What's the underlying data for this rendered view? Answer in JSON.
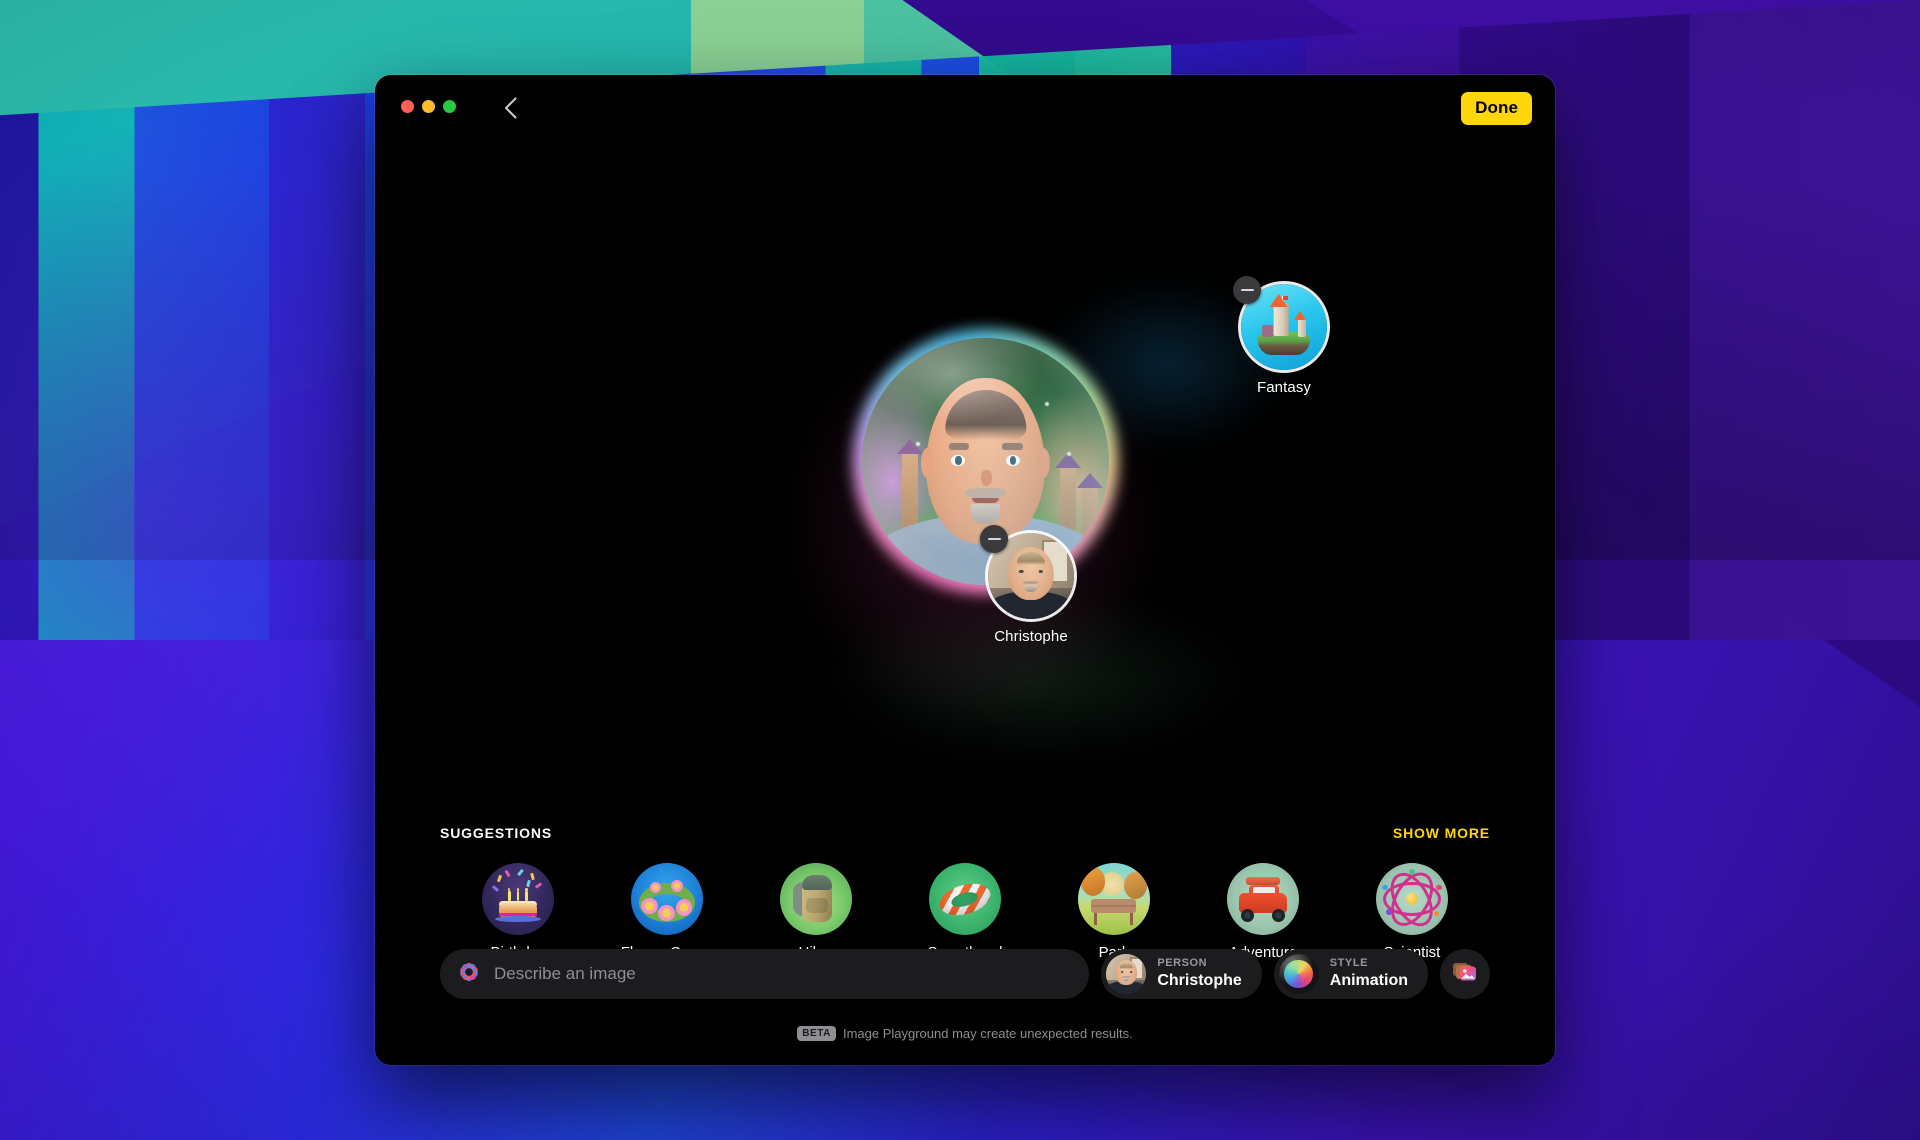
{
  "window": {
    "traffic_lights": {
      "close_label": "close-window",
      "minimize_label": "minimize-window",
      "zoom_label": "zoom-window",
      "close_color": "#ff5f57",
      "minimize_color": "#febc2e",
      "zoom_color": "#28c840"
    },
    "back_label": "Back",
    "done_label": "Done",
    "done_color": "#ffd60a",
    "background_color": "#000000"
  },
  "canvas": {
    "main_image": {
      "name": "generated-image",
      "alt": "Animated-style portrait of Christophe in a fantasy forest village"
    },
    "concepts": [
      {
        "id": "fantasy",
        "label": "Fantasy",
        "remove_label": "Remove Fantasy",
        "art": "castle-island-thumbnail"
      },
      {
        "id": "christophe",
        "label": "Christophe",
        "remove_label": "Remove Christophe",
        "art": "person-photo-thumbnail"
      }
    ]
  },
  "suggestions": {
    "title": "SUGGESTIONS",
    "show_more_label": "SHOW MORE",
    "show_more_color": "#ffd60a",
    "items": [
      {
        "id": "birthday",
        "label": "Birthday",
        "art": "birthday-cake-icon"
      },
      {
        "id": "flower-crown",
        "label": "Flower Crown",
        "art": "flower-crown-icon"
      },
      {
        "id": "hiker",
        "label": "Hiker",
        "art": "backpack-icon"
      },
      {
        "id": "sweatband",
        "label": "Sweatband",
        "art": "sweatband-icon"
      },
      {
        "id": "park",
        "label": "Park",
        "art": "park-bench-icon"
      },
      {
        "id": "adventure",
        "label": "Adventure",
        "art": "off-road-vehicle-icon"
      },
      {
        "id": "scientist",
        "label": "Scientist",
        "art": "atom-icon"
      }
    ]
  },
  "prompt_bar": {
    "describe": {
      "placeholder": "Describe an image",
      "value": "",
      "icon": "apple-intelligence-icon"
    },
    "person_pill": {
      "kicker": "PERSON",
      "value": "Christophe",
      "icon": "person-avatar"
    },
    "style_pill": {
      "kicker": "STYLE",
      "value": "Animation",
      "icon": "style-sphere-icon"
    },
    "photo_button": {
      "label": "Choose photo",
      "icon": "photo-library-icon"
    }
  },
  "footer": {
    "badge": "BETA",
    "text": "Image Playground may create unexpected results."
  }
}
